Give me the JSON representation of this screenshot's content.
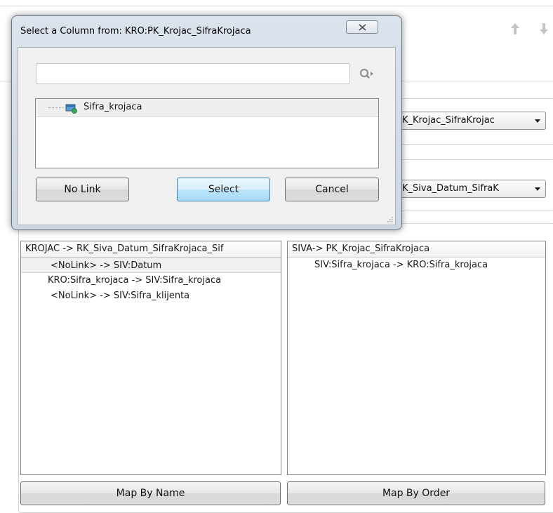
{
  "background": {
    "combo_1_value": "K_Krojac_SifraKrojac",
    "combo_2_value": "K_Siva_Datum_SifraK",
    "left_list": {
      "header": "KROJAC -> RK_Siva_Datum_SifraKrojaca_Sif",
      "rows": [
        "<NoLink> -> SIV:Datum",
        "KRO:Sifra_krojaca -> SIV:Sifra_krojaca",
        "<NoLink> -> SIV:Sifra_klijenta"
      ]
    },
    "right_list": {
      "header": "SIVA-> PK_Krojac_SifraKrojaca",
      "rows": [
        "SIV:Sifra_krojaca -> KRO:Sifra_krojaca"
      ]
    },
    "map_by_name_label": "Map By Name",
    "map_by_order_label": "Map By Order",
    "icons": [
      "arrow-up-icon",
      "arrow-down-icon",
      "combo-arrow-icon"
    ]
  },
  "dialog": {
    "title": "Select a Column from: KRO:PK_Krojac_SifraKrojaca",
    "search": {
      "value": "",
      "placeholder": ""
    },
    "tree_items": [
      "Sifra_krojaca"
    ],
    "buttons": {
      "no_link": "No Link",
      "select": "Select",
      "cancel": "Cancel"
    },
    "icons": [
      "close-icon",
      "search-icon",
      "column-icon",
      "resize-grip-icon"
    ]
  },
  "colors": {
    "dialog_frame": "#cdd7e2",
    "select_button_border": "#3c7fb1",
    "selected_row": "#f0f0f0"
  }
}
